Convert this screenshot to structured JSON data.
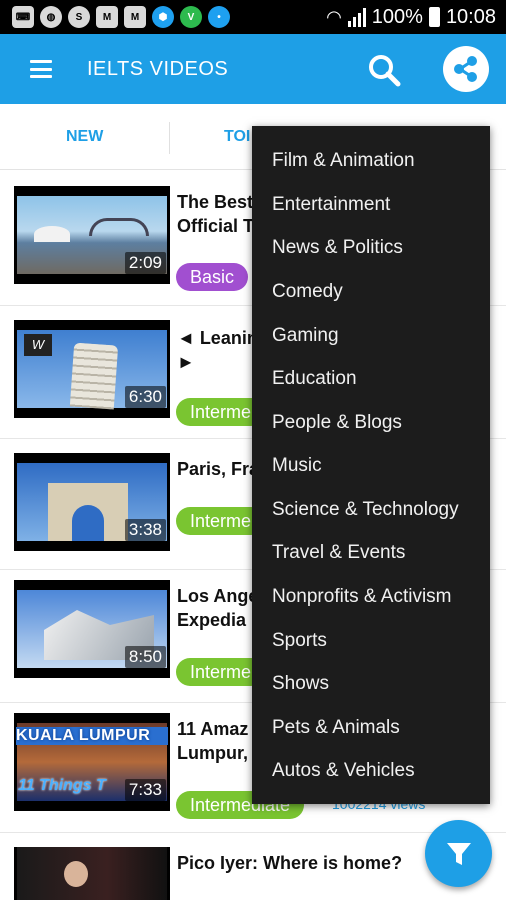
{
  "status_bar": {
    "battery": "100%",
    "time": "10:08",
    "icons": [
      "keyboard-icon",
      "globe-icon",
      "skype-icon",
      "mail-icon",
      "mail-icon",
      "shield-app-icon",
      "vine-icon",
      "app-icon",
      "wifi-icon",
      "signal-icon",
      "battery-icon"
    ]
  },
  "app_bar": {
    "title": "IELTS VIDEOS",
    "menu_icon": "hamburger-icon",
    "search_icon": "search-icon",
    "share_icon": "share-icon"
  },
  "tabs": [
    {
      "label": "NEW"
    },
    {
      "label": "TOI"
    }
  ],
  "videos": [
    {
      "title_line1": "The Best",
      "title_line2": "Official T",
      "duration": "2:09",
      "level": "Basic",
      "views": ""
    },
    {
      "title_line1": "◄ Leanin",
      "title_line2": "►",
      "duration": "6:30",
      "level": "Interme",
      "views": ""
    },
    {
      "title_line1": "Paris, Fra",
      "title_line2": "",
      "duration": "3:38",
      "level": "Interme",
      "views": ""
    },
    {
      "title_line1": "Los Ange",
      "title_line2": "Expedia",
      "duration": "8:50",
      "level": "Interme",
      "views": ""
    },
    {
      "title_line1": "11 Amaz",
      "title_line2": "Lumpur, ",
      "duration": "7:33",
      "level": "Intermediate",
      "views": "1002214 views",
      "thumb_text1": "KUALA LUMPUR",
      "thumb_text2": "11 Things T"
    },
    {
      "title_line1": "Pico Iyer: Where is home?",
      "title_line2": "",
      "duration": "",
      "level": "",
      "views": ""
    }
  ],
  "category_menu": {
    "items": [
      "Film & Animation",
      "Entertainment",
      "News & Politics",
      "Comedy",
      "Gaming",
      "Education",
      "People & Blogs",
      "Music",
      "Science & Technology",
      "Travel & Events",
      "Nonprofits & Activism",
      "Sports",
      "Shows",
      "Pets & Animals",
      "Autos & Vehicles"
    ]
  },
  "fab": {
    "icon": "filter-icon"
  },
  "colors": {
    "primary": "#1e9fe6",
    "basic_badge": "#a14fd0",
    "intermediate_badge": "#7ac531",
    "menu_bg": "#1c1c1c"
  }
}
